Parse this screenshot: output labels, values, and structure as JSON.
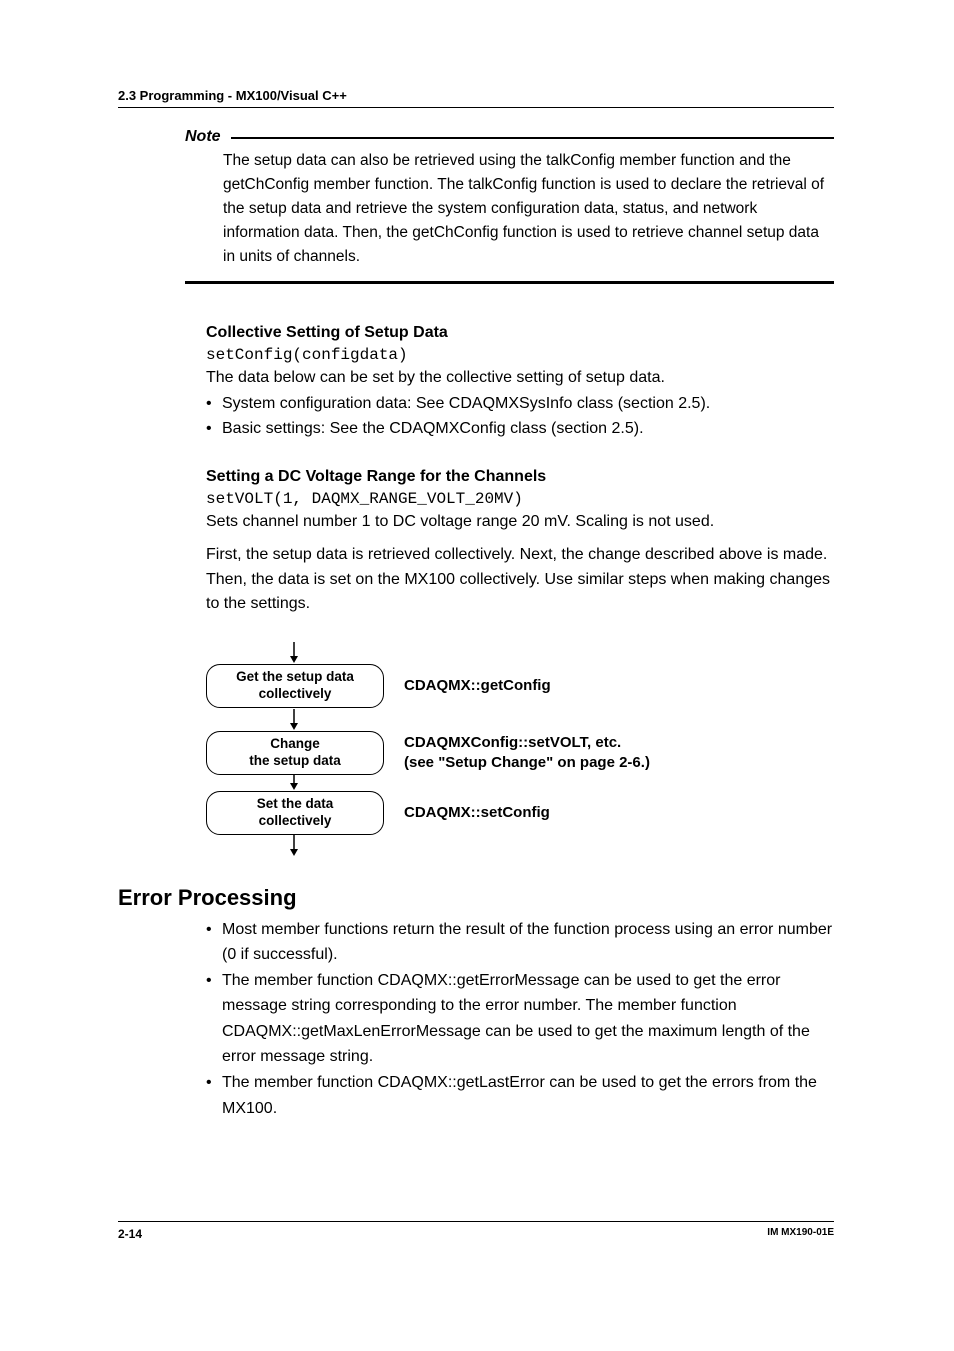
{
  "header": "2.3  Programming - MX100/Visual C++",
  "note": {
    "label": "Note",
    "body": "The setup data can also be retrieved using the talkConfig member function and the getChConfig member function. The talkConfig function is used to declare the retrieval of the setup data and retrieve the system configuration data, status, and network information data. Then, the getChConfig function is used to retrieve channel setup data in units of channels."
  },
  "collective": {
    "heading": "Collective Setting of Setup Data",
    "code": "setConfig(configdata)",
    "intro": "The data below can be set by the collective setting of setup data.",
    "bullets": [
      "System configuration data: See CDAQMXSysInfo class (section 2.5).",
      "Basic settings: See the CDAQMXConfig class (section 2.5)."
    ]
  },
  "dcvolt": {
    "heading": "Setting a DC Voltage Range for the Channels",
    "code": "setVOLT(1, DAQMX_RANGE_VOLT_20MV)",
    "line1": "Sets channel number 1 to DC voltage range 20 mV. Scaling is not used.",
    "line2": "First, the setup data is retrieved collectively. Next, the change described above is made. Then, the data is set on the MX100 collectively. Use similar steps when making changes to the settings."
  },
  "flow": {
    "box1": "Get the setup data collectively",
    "label1": "CDAQMX::getConfig",
    "box2a": "Change",
    "box2b": "the setup data",
    "label2a": "CDAQMXConfig::setVOLT, etc.",
    "label2b": "(see \"Setup Change\" on page 2-6.)",
    "box3a": "Set the data",
    "box3b": "collectively",
    "label3": "CDAQMX::setConfig"
  },
  "errorproc": {
    "title": "Error Processing",
    "bullets": [
      "Most member functions return the result of the function process using an error number (0 if successful).",
      "The member function CDAQMX::getErrorMessage can be used to get the error message string corresponding to the error number. The member function CDAQMX::getMaxLenErrorMessage can be used to get the maximum length of the error message string.",
      "The member function CDAQMX::getLastError can be used to get the errors from the MX100."
    ]
  },
  "footer": {
    "left": "2-14",
    "right": "IM MX190-01E"
  }
}
